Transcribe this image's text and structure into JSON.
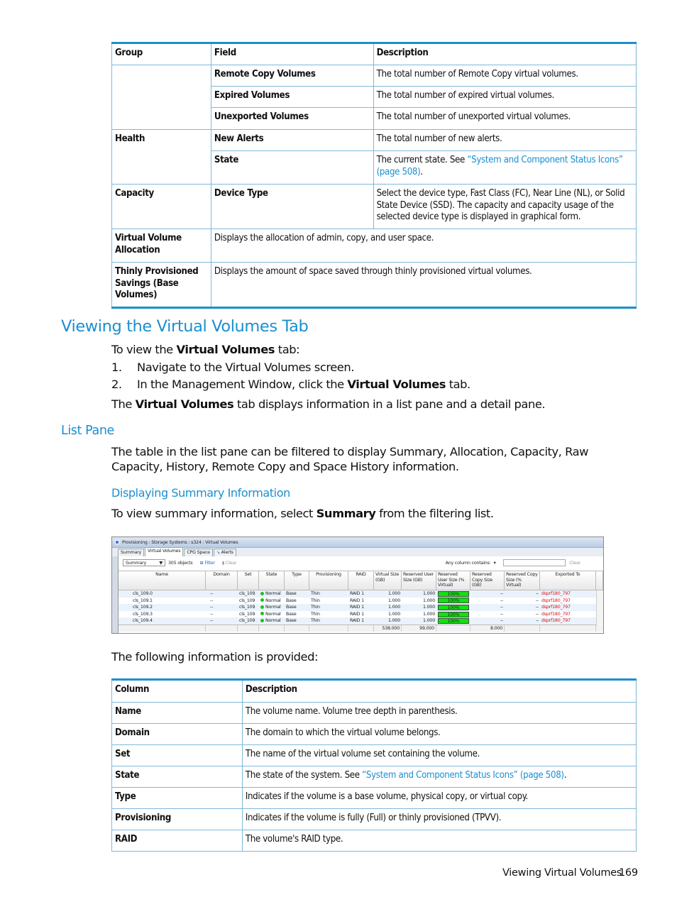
{
  "table1": {
    "headers": [
      "Group",
      "Field",
      "Description"
    ],
    "rows": [
      {
        "group": "",
        "field": "Remote Copy Volumes",
        "desc": "The total number of Remote Copy virtual volumes."
      },
      {
        "group": "",
        "field": "Expired Volumes",
        "desc": "The total number of expired virtual volumes."
      },
      {
        "group": "",
        "field": "Unexported Volumes",
        "desc": "The total number of unexported virtual volumes."
      },
      {
        "group": "Health",
        "field": "New Alerts",
        "desc": "The total number of new alerts."
      },
      {
        "group": "",
        "field": "State",
        "desc_pre": "The current state. See ",
        "desc_link": "“System and Component Status Icons” (page 508)",
        "desc_post": "."
      },
      {
        "group": "Capacity",
        "field": "Device Type",
        "desc": "Select the device type, Fast Class (FC), Near Line (NL), or Solid State Device (SSD). The capacity and capacity usage of the selected device type is displayed in graphical form."
      },
      {
        "group": "Virtual Volume Allocation",
        "desc": "Displays the allocation of admin, copy, and user space."
      },
      {
        "group": "Thinly Provisioned Savings (Base Volumes)",
        "desc": "Displays the amount of space saved through thinly provisioned virtual volumes."
      }
    ]
  },
  "section": {
    "title": "Viewing the Virtual Volumes Tab",
    "intro_pre": "To view the ",
    "intro_bold": "Virtual Volumes",
    "intro_post": " tab:",
    "steps": [
      {
        "num": "1.",
        "pre": "Navigate to the Virtual Volumes screen.",
        "bold": "",
        "post": ""
      },
      {
        "num": "2.",
        "pre": "In the Management Window, click the ",
        "bold": "Virtual Volumes",
        "post": " tab."
      }
    ],
    "summary_pre": "The ",
    "summary_bold": "Virtual Volumes",
    "summary_post": " tab displays information in a list pane and a detail pane."
  },
  "list_pane": {
    "title": "List Pane",
    "text": "The table in the list pane can be filtered to display Summary, Allocation, Capacity, Raw Capacity, History, Remote Copy and Space History information."
  },
  "summary_info": {
    "title": "Displaying Summary Information",
    "text_pre": "To view summary information, select ",
    "text_bold": "Summary",
    "text_post": " from the filtering list."
  },
  "app": {
    "title": "Provisioning : Storage Systems : s324 : Virtual Volumes",
    "tabs": [
      "Summary",
      "Virtual Volumes",
      "CPG Space",
      "Alerts"
    ],
    "active_tab": "Virtual Volumes",
    "filter_select": "Summary",
    "object_count": "305 objects",
    "filter_label": "Filter",
    "clear_label": "Clear",
    "search_label": "Any column contains:",
    "search_value": "",
    "search_clear": "Clear",
    "columns": [
      "Name",
      "Domain",
      "Set",
      "State",
      "Type",
      "Provisioning",
      "RAID",
      "Virtual Size (GB)",
      "Reserved User Size (GB)",
      "Reserved User Size (% Virtual)",
      "Reserved Copy Size (GB)",
      "Reserved Copy Size (% Virtual)",
      "Exported To"
    ],
    "rows": [
      {
        "name": "cls_109.0",
        "domain": "--",
        "set": "cls_109",
        "state": "Normal",
        "type": "Base",
        "prov": "Thin",
        "raid": "RAID 1",
        "vsize": "1.000",
        "rusize": "1.000",
        "rupct": "100%",
        "rcsize": "--",
        "rcpct": "--",
        "exported": "dsprf180_797"
      },
      {
        "name": "cls_109.1",
        "domain": "--",
        "set": "cls_109",
        "state": "Normal",
        "type": "Base",
        "prov": "Thin",
        "raid": "RAID 1",
        "vsize": "1.000",
        "rusize": "1.000",
        "rupct": "100%",
        "rcsize": "--",
        "rcpct": "--",
        "exported": "dsprf180_797"
      },
      {
        "name": "cls_109.2",
        "domain": "--",
        "set": "cls_109",
        "state": "Normal",
        "type": "Base",
        "prov": "Thin",
        "raid": "RAID 1",
        "vsize": "1.000",
        "rusize": "1.000",
        "rupct": "100%",
        "rcsize": "--",
        "rcpct": "--",
        "exported": "dsprf180_797"
      },
      {
        "name": "cls_109.3",
        "domain": "--",
        "set": "cls_109",
        "state": "Normal",
        "type": "Base",
        "prov": "Thin",
        "raid": "RAID 1",
        "vsize": "1.000",
        "rusize": "1.000",
        "rupct": "100%",
        "rcsize": "--",
        "rcpct": "--",
        "exported": "dsprf180_797"
      },
      {
        "name": "cls_109.4",
        "domain": "--",
        "set": "cls_109",
        "state": "Normal",
        "type": "Base",
        "prov": "Thin",
        "raid": "RAID 1",
        "vsize": "1.000",
        "rusize": "1.000",
        "rupct": "100%",
        "rcsize": "--",
        "rcpct": "--",
        "exported": "dsprf180_797"
      }
    ],
    "totals": {
      "vsize": "538.000",
      "rusize": "99.000",
      "rcsize": "8.000"
    },
    "colors": {
      "normal": "#22c020",
      "pct_bar": "#12e012",
      "exported": "#e01010"
    }
  },
  "following_text": "The following information is provided:",
  "table2": {
    "headers": [
      "Column",
      "Description"
    ],
    "rows": [
      {
        "col": "Name",
        "desc": "The volume name. Volume tree depth in parenthesis."
      },
      {
        "col": "Domain",
        "desc": "The domain to which the virtual volume belongs."
      },
      {
        "col": "Set",
        "desc": "The name of the virtual volume set containing the volume."
      },
      {
        "col": "State",
        "desc_pre": "The state of the system. See ",
        "desc_link": "“System and Component Status Icons” (page 508)",
        "desc_post": "."
      },
      {
        "col": "Type",
        "desc": "Indicates if the volume is a base volume, physical copy, or virtual copy."
      },
      {
        "col": "Provisioning",
        "desc": "Indicates if the volume is fully (Full) or thinly provisioned (TPVV)."
      },
      {
        "col": "RAID",
        "desc": "The volume's RAID type."
      }
    ]
  },
  "footer": {
    "section": "Viewing Virtual Volumes",
    "page": "169"
  },
  "colors": {
    "accent": "#1a8fd0",
    "rule": "#7fb7db"
  }
}
